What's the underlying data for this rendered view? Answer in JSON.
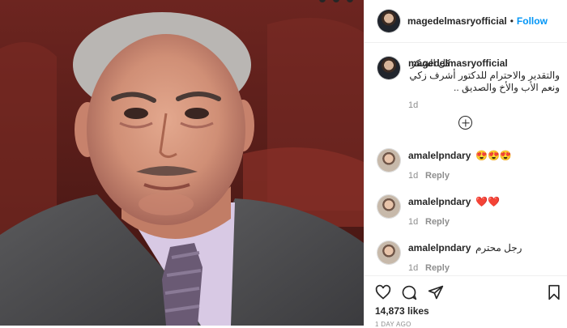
{
  "post": {
    "username": "magedelmasryofficial",
    "separator": "•",
    "follow_label": "Follow",
    "caption": "كل الشكر والتقدير والاحترام للدكتور أشرف زكي ونعم الأب والأخ والصديق ..",
    "caption_age": "1d"
  },
  "comments": [
    {
      "username": "amalelpndary",
      "text": "😍😍😍",
      "age": "1d",
      "reply_label": "Reply"
    },
    {
      "username": "amalelpndary",
      "text": "❤️❤️",
      "age": "1d",
      "reply_label": "Reply"
    },
    {
      "username": "amalelpndary",
      "text": "رجل محترم",
      "age": "1d",
      "reply_label": "Reply"
    }
  ],
  "footer": {
    "likes": "14,873 likes",
    "posted": "1 DAY AGO"
  },
  "icons": {
    "like": "heart-icon",
    "comment": "comment-bubble-icon",
    "share": "share-plane-icon",
    "save": "bookmark-icon",
    "load_more": "plus-circle-icon"
  },
  "colors": {
    "accent": "#0095f6",
    "text": "#262626",
    "muted": "#8e8e8e",
    "divider": "#efefef"
  }
}
